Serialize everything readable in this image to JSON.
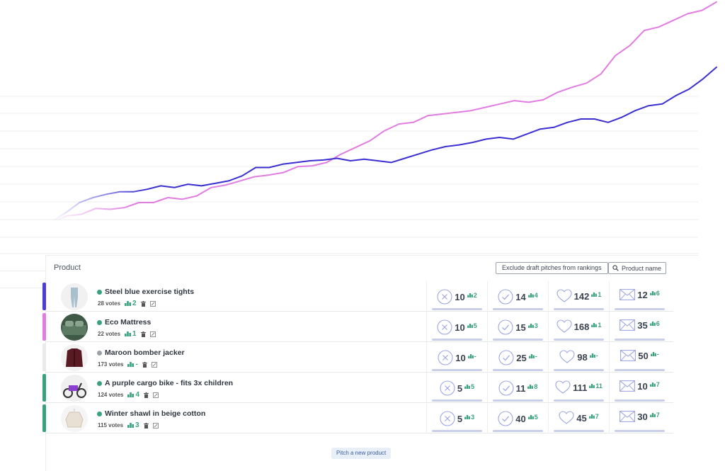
{
  "chart_data": {
    "type": "line",
    "title": "",
    "xlabel": "",
    "ylabel": "",
    "x": [
      0,
      1,
      2,
      3,
      4,
      5,
      6,
      7,
      8,
      9,
      10,
      11,
      12,
      13,
      14,
      15,
      16,
      17,
      18,
      19,
      20,
      21,
      22,
      23,
      24,
      25,
      26,
      27,
      28,
      29,
      30,
      31,
      32,
      33,
      34,
      35,
      36,
      37,
      38,
      39,
      40,
      41,
      42,
      43,
      44,
      45,
      46,
      47,
      48
    ],
    "grid": true,
    "legend": "none",
    "series": [
      {
        "color": "#e07de0",
        "values": [
          0,
          6,
          8,
          15,
          14,
          16,
          22,
          22,
          28,
          26,
          30,
          40,
          43,
          48,
          53,
          55,
          58,
          65,
          66,
          70,
          80,
          88,
          96,
          108,
          116,
          118,
          126,
          128,
          130,
          132,
          136,
          140,
          144,
          142,
          145,
          154,
          160,
          165,
          176,
          198,
          210,
          228,
          232,
          240,
          248,
          252,
          262
        ]
      },
      {
        "color": "#3b2fd1",
        "values": [
          0,
          10,
          22,
          28,
          32,
          35,
          35,
          38,
          42,
          40,
          44,
          42,
          45,
          48,
          54,
          64,
          64,
          68,
          70,
          72,
          73,
          75,
          72,
          74,
          72,
          70,
          75,
          80,
          85,
          89,
          91,
          94,
          98,
          100,
          98,
          104,
          110,
          112,
          118,
          122,
          122,
          118,
          124,
          132,
          138,
          140,
          150,
          158,
          170,
          184
        ]
      }
    ]
  },
  "header": {
    "title": "Product",
    "exclude_label": "Exclude draft pitches from rankings",
    "search_placeholder": "Product name"
  },
  "rows": [
    {
      "accent": "#4a3ed6",
      "status": "#3aa17e",
      "name": "Steel blue exercise tights",
      "votes": "28 votes",
      "rank": "2",
      "m1": {
        "value": "10",
        "delta": "2"
      },
      "m2": {
        "value": "14",
        "delta": "4"
      },
      "m3": {
        "value": "142",
        "delta": "1"
      },
      "m4": {
        "value": "12",
        "delta": "6"
      }
    },
    {
      "accent": "#e07de0",
      "status": "#3aa17e",
      "name": "Eco Mattress",
      "votes": "22 votes",
      "rank": "1",
      "m1": {
        "value": "10",
        "delta": "5"
      },
      "m2": {
        "value": "15",
        "delta": "3"
      },
      "m3": {
        "value": "168",
        "delta": "1"
      },
      "m4": {
        "value": "35",
        "delta": "6"
      }
    },
    {
      "accent": "#e9e9e9",
      "status": "#9aa0a6",
      "name": "Maroon bomber jacker",
      "votes": "173 votes",
      "rank": "-",
      "m1": {
        "value": "10",
        "delta": "-"
      },
      "m2": {
        "value": "25",
        "delta": "-"
      },
      "m3": {
        "value": "98",
        "delta": "-"
      },
      "m4": {
        "value": "50",
        "delta": "-"
      }
    },
    {
      "accent": "#3aa17e",
      "status": "#3aa17e",
      "name": "A purple cargo bike - fits 3x children",
      "votes": "124 votes",
      "rank": "4",
      "m1": {
        "value": "5",
        "delta": "5"
      },
      "m2": {
        "value": "11",
        "delta": "8"
      },
      "m3": {
        "value": "111",
        "delta": "11"
      },
      "m4": {
        "value": "10",
        "delta": "7"
      }
    },
    {
      "accent": "#3aa17e",
      "status": "#3aa17e",
      "name": "Winter shawl in beige cotton",
      "votes": "115 votes",
      "rank": "3",
      "m1": {
        "value": "5",
        "delta": "3"
      },
      "m2": {
        "value": "40",
        "delta": "5"
      },
      "m3": {
        "value": "45",
        "delta": "7"
      },
      "m4": {
        "value": "30",
        "delta": "7"
      }
    }
  ],
  "icons": {
    "m1": "x-circle-icon",
    "m2": "check-circle-icon",
    "m3": "heart-icon",
    "m4": "envelope-icon",
    "rank": "podium-icon",
    "delete": "trash-icon",
    "edit": "edit-icon",
    "search": "search-icon"
  },
  "footer": {
    "pitch_label": "Pitch a new product"
  }
}
